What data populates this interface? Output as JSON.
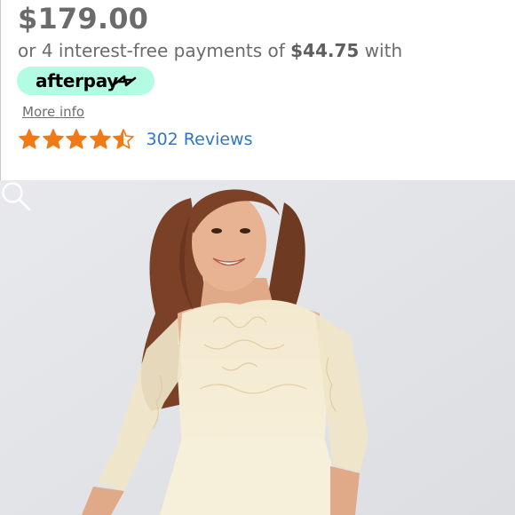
{
  "product": {
    "price": "$179.00",
    "installments_prefix": "or 4 interest-free payments of ",
    "installment_amount": "$44.75",
    "installments_suffix": " with",
    "afterpay_label": "afterpay",
    "more_info": "More info",
    "rating": 4.5,
    "rating_max": 5,
    "reviews_label": "302 Reviews"
  },
  "icons": {
    "star": "star-icon",
    "afterpay_logo": "afterpay-arrows-icon",
    "zoom": "zoom-magnifier-icon"
  },
  "colors": {
    "star": "#f07a14",
    "afterpay_badge": "#b2fce4",
    "reviews_link": "#2f78c4",
    "price_text": "#6b6b6b"
  }
}
